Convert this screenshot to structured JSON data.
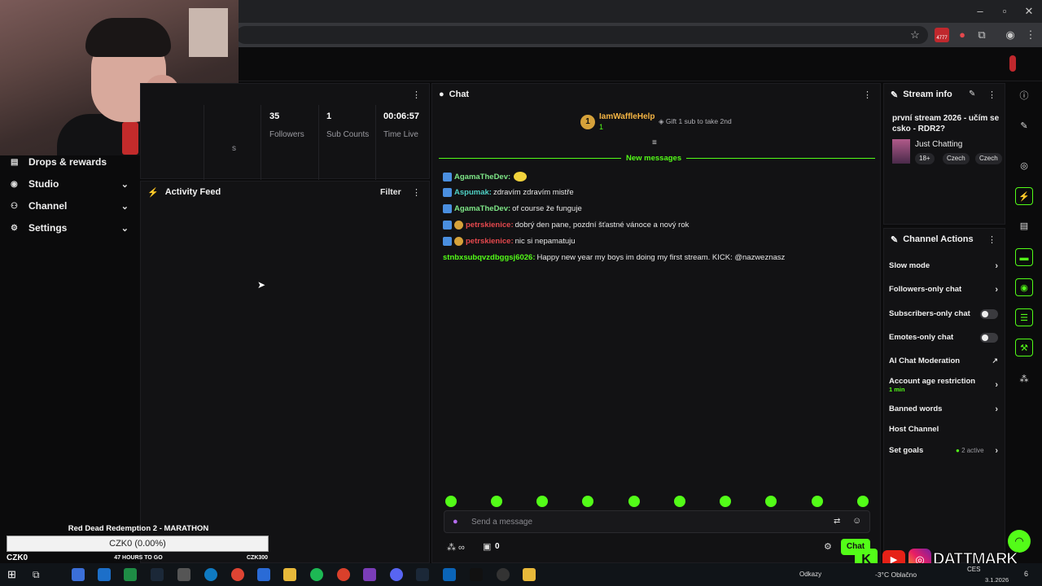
{
  "sidebar": {
    "items": [
      {
        "label": "Drops & rewards",
        "icon": "gift-icon"
      },
      {
        "label": "Studio",
        "icon": "camera-icon"
      },
      {
        "label": "Channel",
        "icon": "users-icon"
      },
      {
        "label": "Settings",
        "icon": "gear-icon"
      }
    ]
  },
  "stats": {
    "followers_value": "35",
    "followers_label": "Followers",
    "subs_value": "1",
    "subs_label": "Sub Counts",
    "time_value": "00:06:57",
    "time_label": "Time Live",
    "cut_label": "s"
  },
  "activity": {
    "title": "Activity Feed",
    "filter": "Filter"
  },
  "chat": {
    "title": "Chat",
    "pinned_user": "IamWaffleHelp",
    "pinned_rank": "1",
    "pinned_sub_count": "1",
    "gift_text": "Gift 1 sub to take 2nd",
    "new_messages": "New messages",
    "messages": [
      {
        "user": "AgamaTheDev:",
        "text": "",
        "color": "#7ee787"
      },
      {
        "user": "Aspumak:",
        "text": "zdravím zdravím mistře",
        "color": "#4fd1c5"
      },
      {
        "user": "AgamaTheDev:",
        "text": "of course že funguje",
        "color": "#7ee787"
      },
      {
        "user": "petrskienice:",
        "text": "dobrý den pane, pozdní šťastné vánoce a nový rok",
        "color": "#e5484d"
      },
      {
        "user": "petrskienice:",
        "text": "nic si nepamatuju",
        "color": "#e5484d"
      },
      {
        "user": "stnbxsubqvzdbggsj6026:",
        "text": "Happy new year my boys im doing my first stream. KICK: @nazweznasz",
        "color": "#53fc18"
      }
    ],
    "input_placeholder": "Send a message",
    "footer_count": "0",
    "chat_button": "Chat"
  },
  "stream_info": {
    "title": "Stream info",
    "stream_title": "první stream 2026 - učím se csko - RDR2?",
    "category": "Just Chatting",
    "tags": [
      "18+",
      "Czech",
      "Czech"
    ]
  },
  "channel_actions": {
    "title": "Channel Actions",
    "items": [
      {
        "label": "Slow mode"
      },
      {
        "label": "Followers-only chat"
      },
      {
        "label": "Subscribers-only chat"
      },
      {
        "label": "Emotes-only chat"
      },
      {
        "label": "AI Chat Moderation"
      },
      {
        "label": "Account age restriction",
        "sub": "1 min"
      },
      {
        "label": "Banned words"
      },
      {
        "label": "Host Channel"
      },
      {
        "label": "Set goals",
        "sub": "2 active"
      }
    ]
  },
  "goal": {
    "title": "Red Dead Redemption 2 - MARATHON",
    "amount": "CZK0 (0.00%)",
    "progress_fraction": 0.0,
    "start": "CZK0",
    "time_left": "47 HOURS TO GO",
    "target": "CZK300"
  },
  "browser": {
    "badge_count": "4777"
  },
  "taskbar": {
    "weather": "-3°C  Oblačno",
    "language": "CES",
    "date": "3.1.2026",
    "links": "Odkazy",
    "notification_count": "6"
  },
  "overlay": {
    "social_handle": "DATTMARK"
  },
  "colors": {
    "accent": "#53fc18",
    "panel": "#121214",
    "background": "#0b0b0c"
  }
}
